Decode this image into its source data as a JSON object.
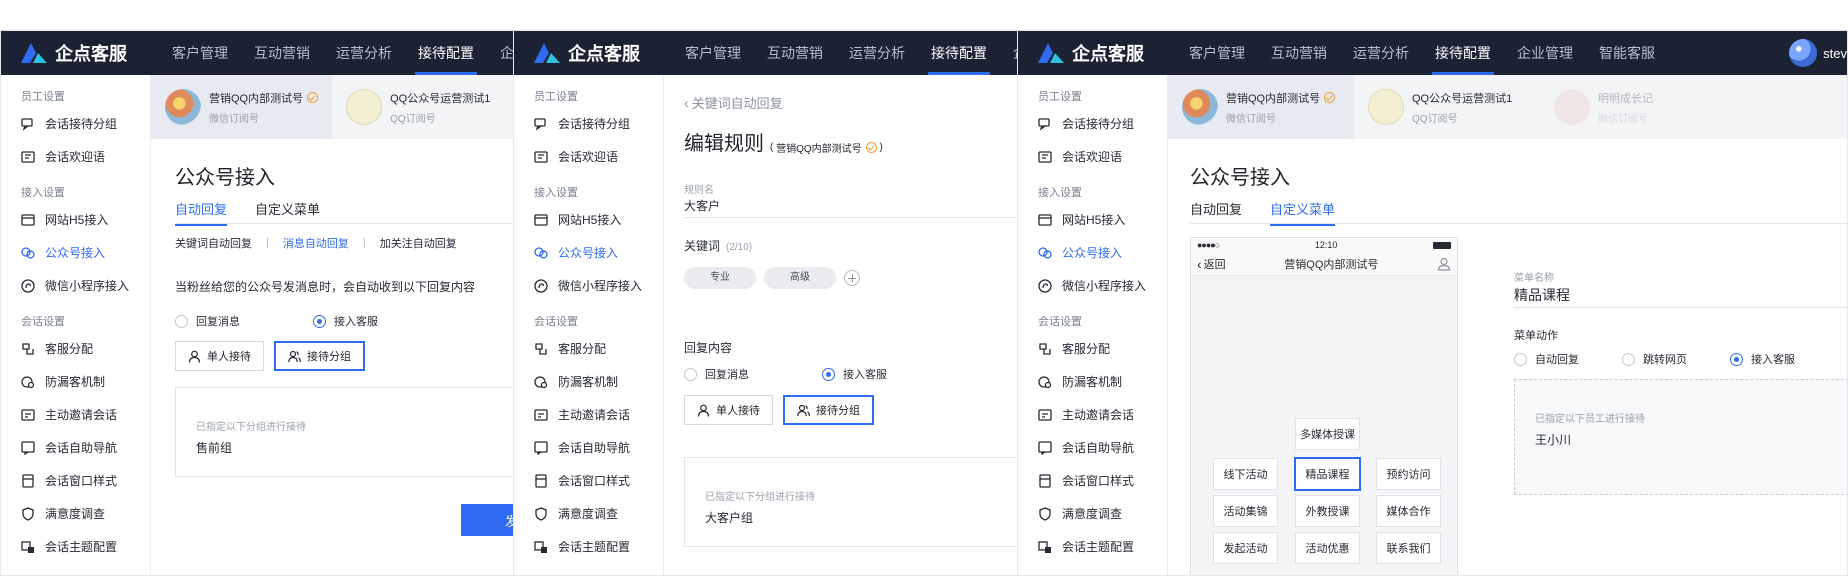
{
  "brand": {
    "name": "企点客服"
  },
  "nav": [
    "客户管理",
    "互动营销",
    "运营分析",
    "接待配置",
    "企业管理",
    "智能客服"
  ],
  "user": {
    "name": "stev"
  },
  "sidebar": {
    "groups": [
      {
        "title": "员工设置",
        "items": [
          {
            "label": "会话接待分组"
          },
          {
            "label": "会话欢迎语"
          }
        ]
      },
      {
        "title": "接入设置",
        "items": [
          {
            "label": "网站H5接入"
          },
          {
            "label": "公众号接入"
          },
          {
            "label": "微信小程序接入"
          }
        ]
      },
      {
        "title": "会话设置",
        "items": [
          {
            "label": "客服分配"
          },
          {
            "label": "防漏客机制"
          },
          {
            "label": "主动邀请会话"
          },
          {
            "label": "会话自助导航"
          },
          {
            "label": "会话窗口样式"
          },
          {
            "label": "满意度调查"
          },
          {
            "label": "会话主题配置"
          }
        ]
      }
    ]
  },
  "accounts": [
    {
      "name": "营销QQ内部测试号",
      "sub": "微信订阅号"
    },
    {
      "name": "QQ公众号运营测试1",
      "sub": "QQ订阅号"
    },
    {
      "name": "明明成长记",
      "sub": "微信订阅号"
    }
  ],
  "panel1": {
    "title": "公众号接入",
    "tabs": [
      "自动回复",
      "自定义菜单"
    ],
    "subtabs": [
      "关键词自动回复",
      "消息自动回复",
      "加关注自动回复"
    ],
    "desc": "当粉丝给您的公众号发消息时，会自动收到以下回复内容",
    "radios": [
      "回复消息",
      "接入客服"
    ],
    "buttons": [
      "单人接待",
      "接待分组"
    ],
    "assign_label": "已指定以下分组进行接待",
    "assign_value": "售前组",
    "submit": "发"
  },
  "panel2": {
    "back": "关键词自动回复",
    "title": "编辑规则",
    "title_account": "营销QQ内部测试号",
    "rule_label": "规则名",
    "rule_value": "大客户",
    "keyword_label": "关键词",
    "keyword_count": "(2/10)",
    "tags": [
      "专业",
      "高级"
    ],
    "reply_label": "回复内容",
    "radios": [
      "回复消息",
      "接入客服"
    ],
    "buttons": [
      "单人接待",
      "接待分组"
    ],
    "assign_label": "已指定以下分组进行接待",
    "assign_value": "大客户组"
  },
  "panel3": {
    "title": "公众号接入",
    "tabs": [
      "自动回复",
      "自定义菜单"
    ],
    "phone": {
      "time": "12:10",
      "back": "返回",
      "title": "营销QQ内部测试号",
      "menu": {
        "media": "多媒体授课",
        "row1": [
          "线下活动",
          "精品课程",
          "预约访问"
        ],
        "row2": [
          "活动集锦",
          "外教授课",
          "媒体合作"
        ],
        "row3": [
          "发起活动",
          "活动优惠",
          "联系我们"
        ]
      }
    },
    "menu_name_label": "菜单名称",
    "menu_name_value": "精品课程",
    "menu_action_label": "菜单动作",
    "radios": [
      "自动回复",
      "跳转网页",
      "接入客服"
    ],
    "assign_label": "已指定以下员工进行接待",
    "assign_value": "王小川"
  },
  "colors": {
    "topbar": "#1b2233",
    "accent": "#2f6bf0",
    "verified": "#f0a030"
  }
}
